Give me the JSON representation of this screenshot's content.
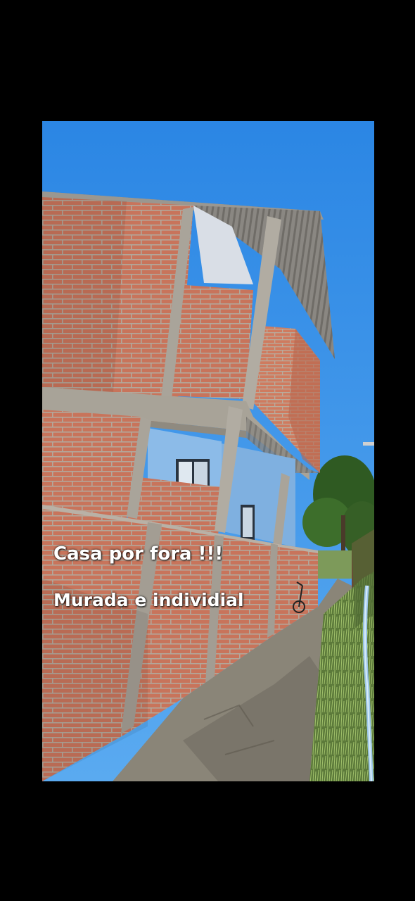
{
  "photo": {
    "subject": "house-exterior",
    "colors": {
      "sky": "#2f8fe8",
      "brick": "#c9735a",
      "concrete": "#a9a49a",
      "roof": "#7d7a75",
      "painted_wall": "#7fb0e0",
      "vegetation": "#3c6b2a",
      "ground": "#8a8578",
      "frame": "#000000"
    }
  },
  "captions": {
    "line1": "Casa por fora !!!",
    "line2": "Murada e individial"
  }
}
